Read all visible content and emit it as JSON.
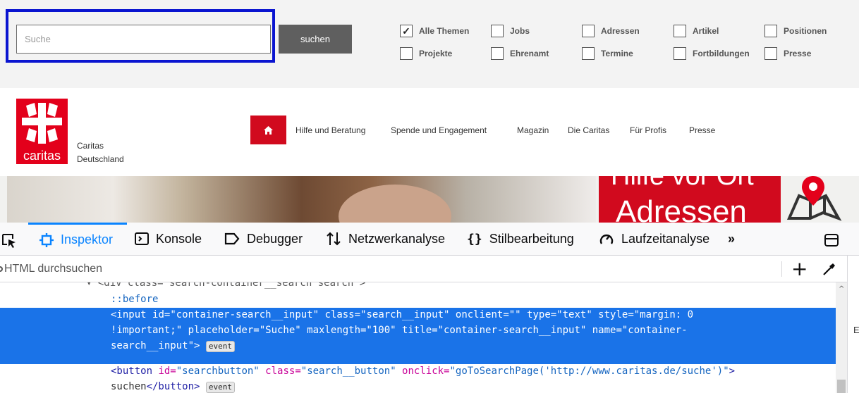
{
  "search": {
    "placeholder": "Suche",
    "button_label": "suchen",
    "filters": [
      {
        "label": "Alle Themen",
        "checked": true
      },
      {
        "label": "Jobs",
        "checked": false
      },
      {
        "label": "Adressen",
        "checked": false
      },
      {
        "label": "Artikel",
        "checked": false
      },
      {
        "label": "Positionen",
        "checked": false
      },
      {
        "label": "Projekte",
        "checked": false
      },
      {
        "label": "Ehrenamt",
        "checked": false
      },
      {
        "label": "Termine",
        "checked": false
      },
      {
        "label": "Fortbildungen",
        "checked": false
      },
      {
        "label": "Presse",
        "checked": false
      }
    ]
  },
  "header": {
    "logo_text": "caritas",
    "org_line1": "Caritas",
    "org_line2": "Deutschland",
    "nav": [
      "Hilfe und Beratung",
      "Spende und Engagement",
      "Magazin",
      "Die Caritas",
      "Für Profis",
      "Presse"
    ]
  },
  "hero": {
    "line1": "Hilfe vor Ort",
    "line2": "Adressen"
  },
  "devtools": {
    "tabs": [
      "Inspektor",
      "Konsole",
      "Debugger",
      "Netzwerkanalyse",
      "Stilbearbeitung",
      "Laufzeitanalyse"
    ],
    "search_placeholder": "HTML durchsuchen",
    "event_badge": "event",
    "tree": {
      "cut_line": "▾ <div class=\"search-container__search search\">",
      "before": "::before",
      "input_line1_a": "<input ",
      "input_id_attr": "id=",
      "input_id_val": "\"container-search__input\"",
      "input_line1_rest": " class=\"search__input\" onclient=\"\" type=\"text\" style=\"margin: 0",
      "input_line2": "!important;\" placeholder=\"Suche\" maxlength=\"100\" title=\"container-search__input\" name=\"container-",
      "input_line3": "search__input\">",
      "button_open": "<button ",
      "button_id_attr": "id=",
      "button_id_val": "\"searchbutton\"",
      "button_class_attr": " class=",
      "button_class_val": "\"search__button\"",
      "button_onclick_attr": " onclick=",
      "button_onclick_val": "\"goToSearchPage('http://www.caritas.de/suche')\"",
      "button_close": ">",
      "button_text": "suchen",
      "button_end": "</button>"
    },
    "right_pane_letter": "E"
  }
}
